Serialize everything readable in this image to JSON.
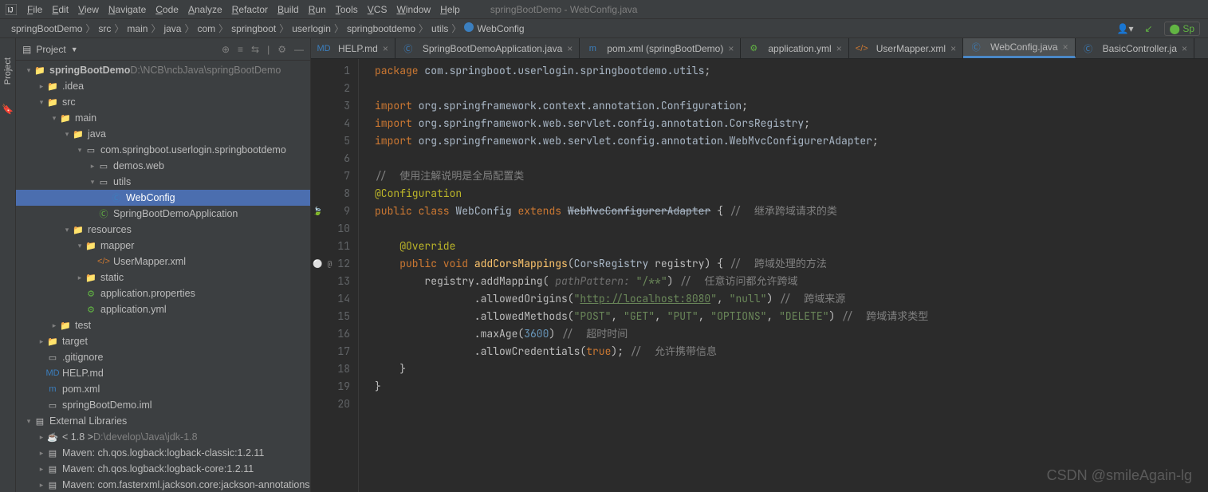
{
  "window_title": "springBootDemo - WebConfig.java",
  "menu": [
    "File",
    "Edit",
    "View",
    "Navigate",
    "Code",
    "Analyze",
    "Refactor",
    "Build",
    "Run",
    "Tools",
    "VCS",
    "Window",
    "Help"
  ],
  "breadcrumbs": [
    "springBootDemo",
    "src",
    "main",
    "java",
    "com",
    "springboot",
    "userlogin",
    "springbootdemo",
    "utils",
    "WebConfig"
  ],
  "right_tools_hint": "Sp",
  "panel": {
    "title": "Project"
  },
  "tree": [
    {
      "depth": 0,
      "tw": "v",
      "icon": "folder",
      "label": "springBootDemo",
      "dim": "  D:\\NCB\\ncbJava\\springBootDemo",
      "bold": true
    },
    {
      "depth": 1,
      "tw": ">",
      "icon": "folder",
      "label": ".idea"
    },
    {
      "depth": 1,
      "tw": "v",
      "icon": "folder-src",
      "label": "src"
    },
    {
      "depth": 2,
      "tw": "v",
      "icon": "folder-src",
      "label": "main"
    },
    {
      "depth": 3,
      "tw": "v",
      "icon": "folder-src",
      "label": "java"
    },
    {
      "depth": 4,
      "tw": "v",
      "icon": "package",
      "label": "com.springboot.userlogin.springbootdemo"
    },
    {
      "depth": 5,
      "tw": ">",
      "icon": "package",
      "label": "demos.web"
    },
    {
      "depth": 5,
      "tw": "v",
      "icon": "package",
      "label": "utils"
    },
    {
      "depth": 6,
      "tw": "",
      "icon": "class",
      "label": "WebConfig",
      "selected": true
    },
    {
      "depth": 5,
      "tw": "",
      "icon": "class-run",
      "label": "SpringBootDemoApplication"
    },
    {
      "depth": 3,
      "tw": "v",
      "icon": "folder-res",
      "label": "resources"
    },
    {
      "depth": 4,
      "tw": "v",
      "icon": "folder",
      "label": "mapper"
    },
    {
      "depth": 5,
      "tw": "",
      "icon": "xml",
      "label": "UserMapper.xml"
    },
    {
      "depth": 4,
      "tw": ">",
      "icon": "folder",
      "label": "static"
    },
    {
      "depth": 4,
      "tw": "",
      "icon": "props",
      "label": "application.properties"
    },
    {
      "depth": 4,
      "tw": "",
      "icon": "props",
      "label": "application.yml"
    },
    {
      "depth": 2,
      "tw": ">",
      "icon": "folder",
      "label": "test"
    },
    {
      "depth": 1,
      "tw": ">",
      "icon": "folder-target",
      "label": "target"
    },
    {
      "depth": 1,
      "tw": "",
      "icon": "file",
      "label": ".gitignore"
    },
    {
      "depth": 1,
      "tw": "",
      "icon": "md",
      "label": "HELP.md"
    },
    {
      "depth": 1,
      "tw": "",
      "icon": "maven",
      "label": "pom.xml"
    },
    {
      "depth": 1,
      "tw": "",
      "icon": "file",
      "label": "springBootDemo.iml"
    },
    {
      "depth": 0,
      "tw": "v",
      "icon": "lib",
      "label": "External Libraries"
    },
    {
      "depth": 1,
      "tw": ">",
      "icon": "jdk",
      "label": "< 1.8 >",
      "dim": "  D:\\develop\\Java\\jdk-1.8"
    },
    {
      "depth": 1,
      "tw": ">",
      "icon": "lib",
      "label": "Maven: ch.qos.logback:logback-classic:1.2.11"
    },
    {
      "depth": 1,
      "tw": ">",
      "icon": "lib",
      "label": "Maven: ch.qos.logback:logback-core:1.2.11"
    },
    {
      "depth": 1,
      "tw": ">",
      "icon": "lib",
      "label": "Maven: com.fasterxml.jackson.core:jackson-annotations"
    }
  ],
  "tabs": [
    {
      "icon": "md",
      "label": "HELP.md"
    },
    {
      "icon": "class",
      "label": "SpringBootDemoApplication.java"
    },
    {
      "icon": "maven",
      "label": "pom.xml (springBootDemo)"
    },
    {
      "icon": "props",
      "label": "application.yml"
    },
    {
      "icon": "xml",
      "label": "UserMapper.xml"
    },
    {
      "icon": "class",
      "label": "WebConfig.java",
      "active": true
    },
    {
      "icon": "class",
      "label": "BasicController.ja"
    }
  ],
  "code_lines": [
    {
      "n": 1,
      "html": "<span class='kw'>package</span> <span class='cls'>com.springboot.userlogin.springbootdemo.utils</span>;"
    },
    {
      "n": 2,
      "html": ""
    },
    {
      "n": 3,
      "html": "<span class='kw'>import</span> <span class='cls'>org.springframework.context.annotation.</span><span class='cls' style='color:#a9b7c6'>Configuration</span>;"
    },
    {
      "n": 4,
      "html": "<span class='kw'>import</span> <span class='cls'>org.springframework.web.servlet.config.annotation.CorsRegistry</span>;"
    },
    {
      "n": 5,
      "html": "<span class='kw'>import</span> <span class='cls'>org.springframework.web.servlet.config.annotation.WebMvcConfigurerAdapter</span>;"
    },
    {
      "n": 6,
      "html": ""
    },
    {
      "n": 7,
      "html": "<span class='cm'>//  使用注解说明是全局配置类</span>"
    },
    {
      "n": 8,
      "html": "<span class='ann'>@Configuration</span>"
    },
    {
      "n": 9,
      "html": "<span class='kw'>public class</span> <span class='cls'>WebConfig</span> <span class='kw'>extends</span> <span class='strike'>WebMvcConfigurerAdapter</span> { <span class='cm'>//  继承跨域请求的类</span>",
      "gutter": "🍃"
    },
    {
      "n": 10,
      "html": ""
    },
    {
      "n": 11,
      "html": "    <span class='ann'>@Override</span>"
    },
    {
      "n": 12,
      "html": "    <span class='kw'>public void</span> <span class='fn'>addCorsMappings</span>(<span class='cls'>CorsRegistry</span> registry) { <span class='cm'>//  跨域处理的方法</span>",
      "gutter": "⚪ @"
    },
    {
      "n": 13,
      "html": "        registry.addMapping( <span class='param-hint'>pathPattern:</span> <span class='str'>\"/**\"</span>) <span class='cm'>//  任意访问都允许跨域</span>"
    },
    {
      "n": 14,
      "html": "                .allowedOrigins(<span class='str'>\"<u>http://localhost:8080</u>\"</span>, <span class='str'>\"null\"</span>) <span class='cm'>//  跨域来源</span>"
    },
    {
      "n": 15,
      "html": "                .allowedMethods(<span class='str'>\"POST\"</span>, <span class='str'>\"GET\"</span>, <span class='str'>\"PUT\"</span>, <span class='str'>\"OPTIONS\"</span>, <span class='str'>\"DELETE\"</span>) <span class='cm'>//  跨域请求类型</span>"
    },
    {
      "n": 16,
      "html": "                .maxAge(<span class='num'>3600</span>) <span class='cm'>//  超时时间</span>"
    },
    {
      "n": 17,
      "html": "                .allowCredentials(<span class='kw'>true</span>); <span class='cm'>//  允许携带信息</span>"
    },
    {
      "n": 18,
      "html": "    }"
    },
    {
      "n": 19,
      "html": "}"
    },
    {
      "n": 20,
      "html": ""
    }
  ],
  "watermark": "CSDN @smileAgain-lg"
}
